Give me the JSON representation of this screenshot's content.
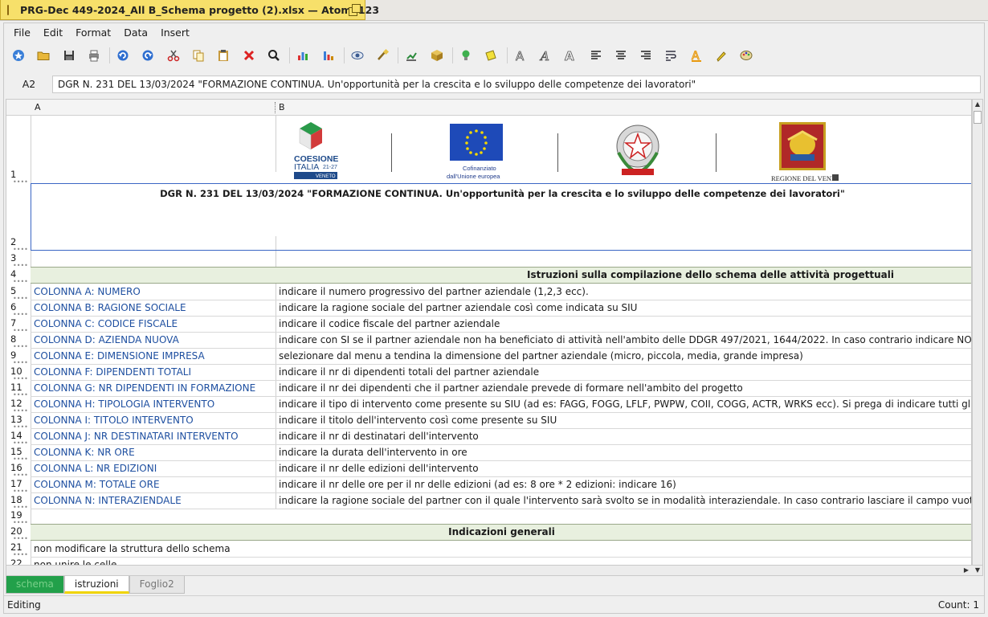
{
  "window": {
    "title": "PRG-Dec 449-2024_All B_Schema progetto (2).xlsx — Atomo123"
  },
  "menu": [
    "File",
    "Edit",
    "Format",
    "Data",
    "Insert"
  ],
  "toolbar": {
    "icons": [
      "new-icon",
      "open-icon",
      "save-icon",
      "print-icon",
      "undo-icon",
      "redo-icon",
      "cut-icon",
      "copy-icon",
      "paste-icon",
      "delete-icon",
      "find-icon",
      "chart-icon",
      "bar-chart-icon",
      "view-icon",
      "brush-icon",
      "sort-icon",
      "package-icon",
      "bulb-icon",
      "tag-icon",
      "font-outline-icon",
      "italic-font-icon",
      "font-bold-outline-icon",
      "align-left-icon",
      "align-center-icon",
      "align-right-icon",
      "wrap-icon",
      "text-color-icon",
      "highlight-icon",
      "palette-icon"
    ]
  },
  "formula_bar": {
    "cell_ref": "A2",
    "value": "DGR N. 231 DEL 13/03/2024 \"FORMAZIONE CONTINUA. Un'opportunità per la crescita e lo sviluppo delle competenze dei lavoratori\""
  },
  "columns": [
    "A",
    "B"
  ],
  "logos": {
    "coesione_line1": "COESIONE",
    "coesione_line2": "ITALIA",
    "coesione_years": "21-27",
    "coesione_region": "VENETO",
    "eu_line1": "Cofinanziato",
    "eu_line2": "dall'Unione europea",
    "regione": "REGIONE DEL VENE"
  },
  "rows": [
    {
      "num": "1"
    },
    {
      "num": "2",
      "title": "DGR N. 231 DEL 13/03/2024 \"FORMAZIONE CONTINUA. Un'opportunità per la crescita e lo sviluppo delle competenze dei lavoratori\""
    },
    {
      "num": "3"
    },
    {
      "num": "4",
      "header": "Istruzioni sulla compilazione dello schema delle attività progettuali"
    },
    {
      "num": "5",
      "a": "COLONNA A: NUMERO",
      "b": "indicare il numero progressivo del partner aziendale (1,2,3 ecc)."
    },
    {
      "num": "6",
      "a": "COLONNA B: RAGIONE SOCIALE",
      "b": "indicare la ragione sociale del partner aziendale così come indicata su SIU"
    },
    {
      "num": "7",
      "a": "COLONNA C: CODICE FISCALE",
      "b": "indicare il codice fiscale del partner aziendale"
    },
    {
      "num": "8",
      "a": "COLONNA D: AZIENDA NUOVA",
      "b": "indicare con SI se il partner aziendale non ha beneficiato di attività nell'ambito delle DDGR 497/2021, 1644/2022. In caso contrario indicare NO."
    },
    {
      "num": "9",
      "a": "COLONNA E: DIMENSIONE IMPRESA",
      "b": "selezionare dal menu a tendina la dimensione del partner aziendale (micro, piccola, media, grande impresa)"
    },
    {
      "num": "10",
      "a": "COLONNA F: DIPENDENTI TOTALI",
      "b": "indicare il nr di dipendenti totali del partner aziendale"
    },
    {
      "num": "11",
      "a": "COLONNA G: NR DIPENDENTI IN FORMAZIONE",
      "b": "indicare il nr  dei dipendenti che il partner aziendale prevede di formare nell'ambito del progetto"
    },
    {
      "num": "12",
      "a": "COLONNA H: TIPOLOGIA INTERVENTO",
      "b": "indicare il tipo di intervento come presente su SIU (ad es: FAGG, FOGG, LFLF, PWPW, COII, COGG, ACTR, WRKS ecc). Si prega di indicare tutti gli interventi pre"
    },
    {
      "num": "13",
      "a": "COLONNA I: TITOLO INTERVENTO",
      "b": "indicare il titolo dell'intervento così come presente su SIU"
    },
    {
      "num": "14",
      "a": "COLONNA J: NR DESTINATARI INTERVENTO",
      "b": "indicare il nr di destinatari dell'intervento"
    },
    {
      "num": "15",
      "a": "COLONNA K: NR ORE",
      "b": "indicare la durata dell'intervento in ore"
    },
    {
      "num": "16",
      "a": "COLONNA L: NR EDIZIONI",
      "b": "indicare il nr delle edizioni dell'intervento"
    },
    {
      "num": "17",
      "a": "COLONNA M: TOTALE ORE",
      "b": "indicare il nr delle ore per il nr delle edizioni (ad es: 8 ore * 2 edizioni: indicare 16)"
    },
    {
      "num": "18",
      "a": "COLONNA N: INTERAZIENDALE",
      "b": "indicare la ragione sociale del partner  con il quale l'intervento sarà svolto se in modalità interaziendale. In caso contrario lasciare il campo vuoto."
    },
    {
      "num": "19"
    },
    {
      "num": "20",
      "header": "Indicazioni generali"
    },
    {
      "num": "21",
      "a": "non modificare la struttura dello schema"
    },
    {
      "num": "22",
      "a": "non unire le celle"
    }
  ],
  "sheet_tabs": [
    "schema",
    "istruzioni",
    "Foglio2"
  ],
  "status": {
    "left": "Editing",
    "right": "Count: 1"
  }
}
